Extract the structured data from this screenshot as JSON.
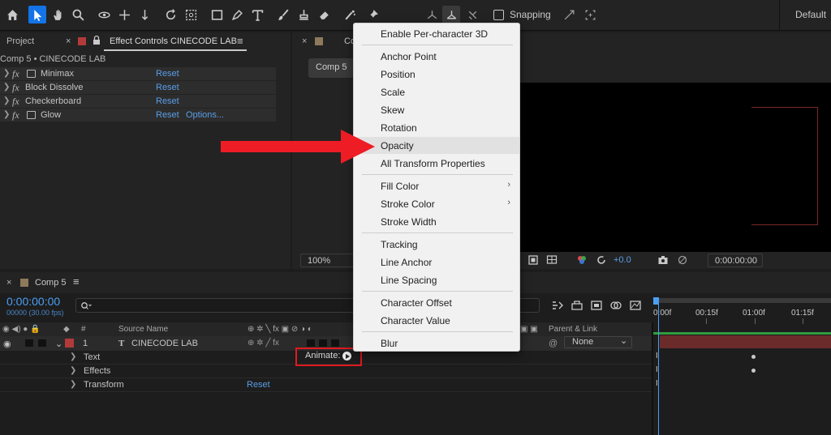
{
  "toolbar": {
    "snapping_label": "Snapping",
    "workspace_label": "Default",
    "accent_color": "#1473e6"
  },
  "left_panel": {
    "project_tab": "Project",
    "effect_controls_tab": "Effect Controls CINECODE LAB",
    "comp_label": "Comp 5 • CINECODE LAB",
    "effects": [
      {
        "name": "Minimax",
        "reset": "Reset",
        "has_icon": true
      },
      {
        "name": "Block Dissolve",
        "reset": "Reset",
        "has_icon": false
      },
      {
        "name": "Checkerboard",
        "reset": "Reset",
        "has_icon": false
      },
      {
        "name": "Glow",
        "reset": "Reset",
        "options": "Options...",
        "has_icon": true
      }
    ]
  },
  "viewer": {
    "tab_partial": "Co",
    "comp_chip": "Comp 5",
    "zoom": "100%",
    "exposure": "+0.0",
    "time": "0:00:00:00"
  },
  "context_menu": {
    "groups": [
      [
        "Enable Per-character 3D"
      ],
      [
        "Anchor Point",
        "Position",
        "Scale",
        "Skew",
        "Rotation",
        "Opacity",
        "All Transform Properties"
      ],
      [
        "Fill Color",
        "Stroke Color",
        "Stroke Width"
      ],
      [
        "Tracking",
        "Line Anchor",
        "Line Spacing"
      ],
      [
        "Character Offset",
        "Character Value"
      ],
      [
        "Blur"
      ]
    ],
    "highlighted": "Opacity",
    "submenu_items": [
      "Fill Color",
      "Stroke Color"
    ]
  },
  "timeline": {
    "tab": "Comp 5",
    "timecode": "0:00:00:00",
    "fps": "00000 (30.00 fps)",
    "columns": {
      "num": "#",
      "source_name": "Source Name",
      "parent_link": "Parent & Link"
    },
    "ruler": [
      "0:00f",
      "00:15f",
      "01:00f",
      "01:15f"
    ],
    "layer": {
      "index": "1",
      "type_glyph": "T",
      "name": "CINECODE LAB",
      "parent": "None"
    },
    "sub_rows": [
      {
        "label": "Text",
        "animate_label": "Animate:"
      },
      {
        "label": "Effects"
      },
      {
        "label": "Transform",
        "reset": "Reset"
      }
    ]
  }
}
